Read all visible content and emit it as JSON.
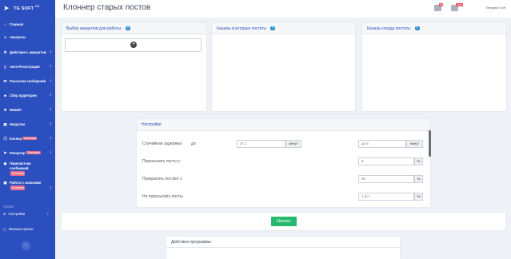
{
  "brand": {
    "name": "TG SOFT",
    "version": "2.6"
  },
  "topbar": {
    "title": "Клоннер старых постов",
    "user": "Telegram Soft",
    "badge1": "98",
    "badge2": "1285"
  },
  "sidebar": {
    "items": [
      {
        "label": "Главная",
        "icon": "home-icon",
        "chevron": false
      },
      {
        "label": "Аккаунты",
        "icon": "user-icon",
        "chevron": false
      },
      {
        "label": "Действия с аккаунтом",
        "icon": "gear-icon",
        "chevron": true
      },
      {
        "label": "Авто-Регистрация",
        "icon": "phone-icon",
        "chevron": true
      },
      {
        "label": "Рассылка сообщений",
        "icon": "mail-icon",
        "chevron": true
      },
      {
        "label": "Сбор аудитории",
        "icon": "users-icon",
        "chevron": true
      },
      {
        "label": "Инвайт",
        "icon": "invite-icon",
        "chevron": true
      },
      {
        "label": "Накрутки",
        "icon": "chart-icon",
        "chevron": true
      },
      {
        "label": "Клонер",
        "icon": "clone-icon",
        "chevron": true,
        "pro": "Премиум"
      },
      {
        "label": "Репортер",
        "icon": "flag-icon",
        "chevron": true,
        "pro": "Премиум"
      },
      {
        "label": "Перехватчик сообщений",
        "icon": "intercept-icon",
        "chevron": false,
        "pro": "Премиум"
      },
      {
        "label": "Работа с каналами",
        "icon": "channel-icon",
        "chevron": true,
        "pro": "Премиум"
      }
    ],
    "section_label": "ПРОЕКТ",
    "settings": "Настройки",
    "shop": "Магазин прокси",
    "collapse": "‹"
  },
  "panels": {
    "accounts": {
      "title": "Выбор аккаунтов для работы:",
      "count": "0"
    },
    "target": {
      "title": "Каналы в которые постить:",
      "count": "0"
    },
    "source": {
      "title": "Каналы откуда постить:",
      "count": "0"
    }
  },
  "settings": {
    "title": "Настройки",
    "delay_label": "Случайная задержка:",
    "delay_from_placeholder": "от 1",
    "delay_to_placeholder": "до 5",
    "do_label": "до",
    "minutes": "минут",
    "repost_from_label": "Пересылать посты с",
    "repost_from_value": "5",
    "stop_label": "Прекратить постинг с",
    "stop_value": "50",
    "skip_label": "Не пересылать посты",
    "skip_value": "1,2,n",
    "unit_n": "№"
  },
  "start": {
    "label": "Начать"
  },
  "actions": {
    "title": "Действия программы:"
  },
  "colors": {
    "accent": "#2c4fbf",
    "start": "#28b96d",
    "badge": "#2c8fd6"
  }
}
